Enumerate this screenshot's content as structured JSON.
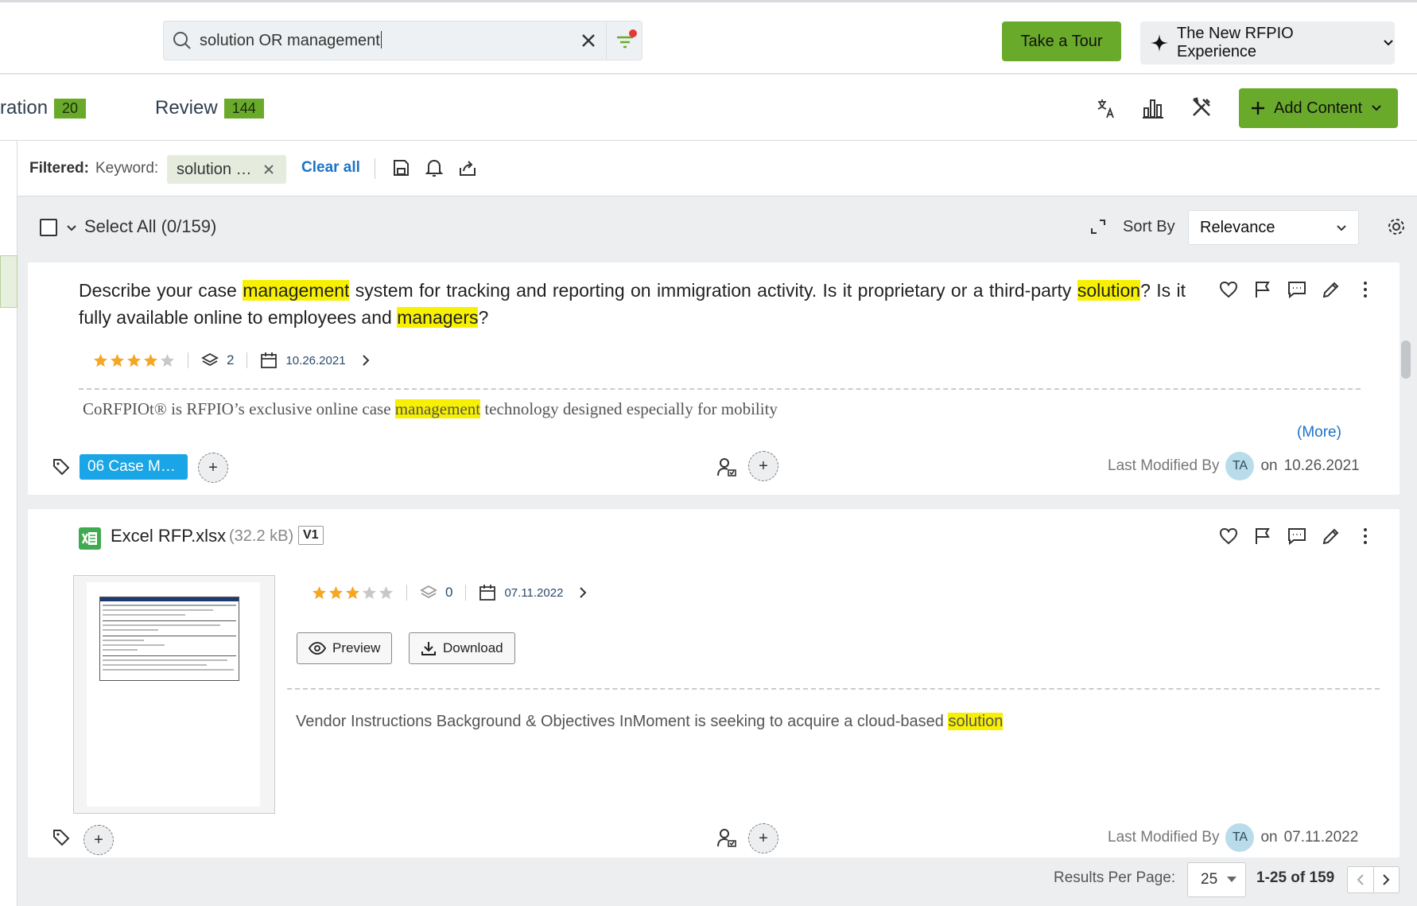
{
  "search": {
    "query": "solution OR management"
  },
  "header": {
    "tour_label": "Take a Tour",
    "experience_label": "The New RFPIO Experience"
  },
  "tabs": [
    {
      "label": "ration",
      "count": "20"
    },
    {
      "label": "Review",
      "count": "144"
    }
  ],
  "toolbar": {
    "add_content_label": "Add Content"
  },
  "filter": {
    "prefix": "Filtered:",
    "keyword_label": "Keyword:",
    "keyword_chip": "solution …",
    "clear_all": "Clear all"
  },
  "list": {
    "select_all": "Select All (0/159)",
    "sort_by_label": "Sort By",
    "sort_value": "Relevance"
  },
  "cards": [
    {
      "question_parts": [
        "Describe your case ",
        "management",
        " system for tracking and reporting on immigration activity. Is it proprietary or a third-party ",
        "solution",
        "?  Is it fully available online to employees and ",
        "managers",
        "?"
      ],
      "rating": 4,
      "versions": "2",
      "date": "10.26.2021",
      "answer_parts": [
        "CoRFPIOt® is RFPIO’s exclusive online case ",
        "management",
        " technology designed especially for mobility"
      ],
      "more_label": "(More)",
      "tag": "06 Case M…",
      "last_modified_label": "Last Modified By",
      "avatar": "TA",
      "on_label": "on",
      "modified_date": "10.26.2021"
    },
    {
      "file_name": "Excel RFP.xlsx",
      "file_size": "(32.2 kB)",
      "version": "V1",
      "rating": 3,
      "versions": "0",
      "date": "07.11.2022",
      "preview_label": "Preview",
      "download_label": "Download",
      "answer_parts": [
        "Vendor Instructions Background & Objectives InMoment is seeking to acquire a cloud-based ",
        "solution"
      ],
      "last_modified_label": "Last Modified By",
      "avatar": "TA",
      "on_label": "on",
      "modified_date": "07.11.2022"
    }
  ],
  "pager": {
    "per_page_label": "Results Per Page:",
    "per_page": "25",
    "range": "1-25 of 159"
  },
  "colors": {
    "accent_green": "#6aaa2a",
    "highlight": "#f7f000",
    "tag_blue": "#19a5e6",
    "link_blue": "#1a73c8"
  }
}
